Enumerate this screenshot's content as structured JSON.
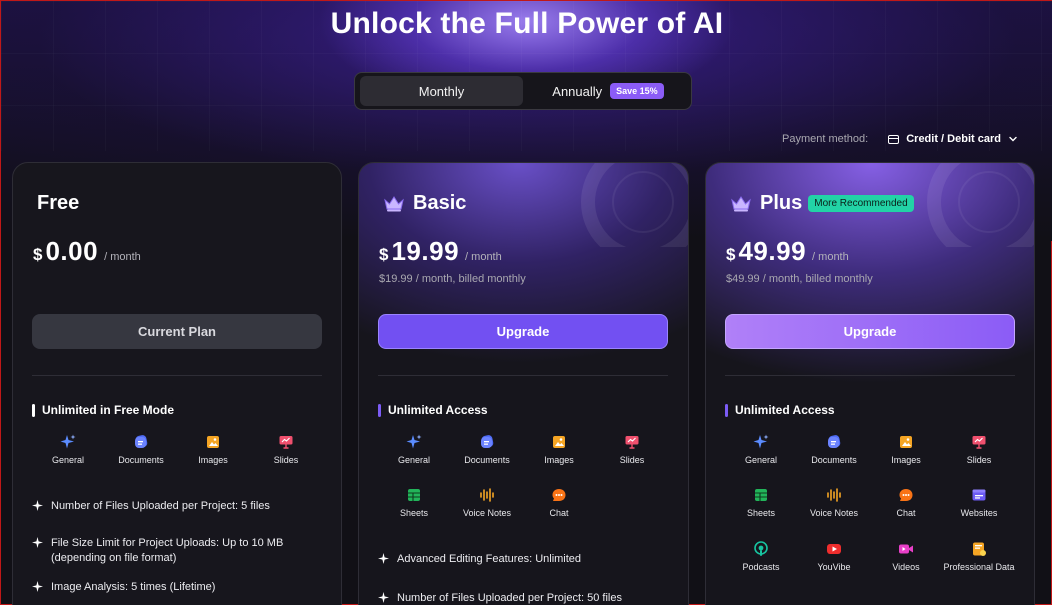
{
  "header": {
    "title": "Unlock the Full Power of AI"
  },
  "billing_toggle": {
    "monthly_label": "Monthly",
    "annually_label": "Annually",
    "save_badge": "Save 15%",
    "selected": "Monthly"
  },
  "payment": {
    "label": "Payment method:",
    "value": "Credit / Debit card",
    "icon": "credit-card-icon"
  },
  "colors": {
    "accent": "#7250f2",
    "plus_badge": "#22d3a6",
    "save_badge": "#8b5cf6"
  },
  "plans": {
    "free": {
      "name": "Free",
      "currency": "$",
      "price": "0.00",
      "period": "/ month",
      "button": "Current Plan",
      "section_title": "Unlimited in Free Mode",
      "features": [
        "General",
        "Documents",
        "Images",
        "Slides"
      ],
      "bullets": [
        "Number of Files Uploaded per Project: 5 files",
        "File Size Limit for Project Uploads: Up to 10 MB (depending on file format)",
        "Image Analysis: 5 times (Lifetime)"
      ]
    },
    "basic": {
      "name": "Basic",
      "currency": "$",
      "price": "19.99",
      "period": "/ month",
      "billed": "$19.99 / month, billed monthly",
      "button": "Upgrade",
      "section_title": "Unlimited Access",
      "features": [
        "General",
        "Documents",
        "Images",
        "Slides",
        "Sheets",
        "Voice Notes",
        "Chat"
      ],
      "bullets": [
        "Advanced Editing Features: Unlimited",
        "Number of Files Uploaded per Project: 50 files"
      ]
    },
    "plus": {
      "name": "Plus",
      "badge": "More Recommended",
      "currency": "$",
      "price": "49.99",
      "period": "/ month",
      "billed": "$49.99 / month, billed monthly",
      "button": "Upgrade",
      "section_title": "Unlimited Access",
      "features": [
        "General",
        "Documents",
        "Images",
        "Slides",
        "Sheets",
        "Voice Notes",
        "Chat",
        "Websites",
        "Podcasts",
        "YouVibe",
        "Videos",
        "Professional Data"
      ]
    }
  }
}
